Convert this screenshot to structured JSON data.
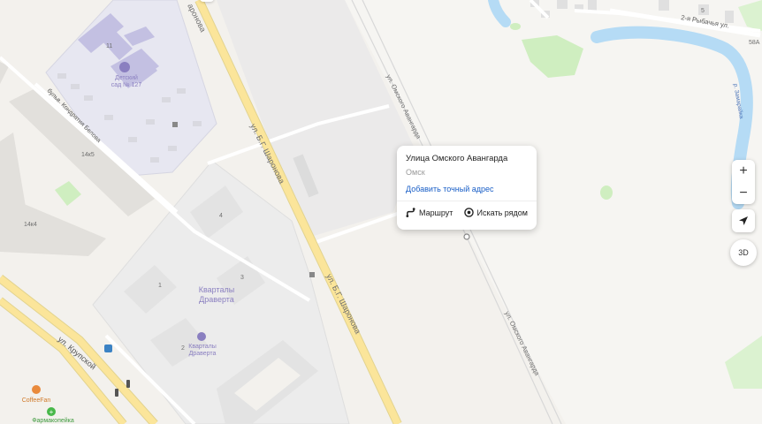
{
  "popup": {
    "title": "Улица Омского Авангарда",
    "city": "Омск",
    "add_address": "Добавить точный адрес",
    "route_label": "Маршрут",
    "search_nearby_label": "Искать рядом"
  },
  "controls": {
    "zoom_in": "+",
    "zoom_out": "−",
    "three_d": "3D"
  },
  "map_labels": {
    "street_sharonova": "ул. Б.Г. Шаронова",
    "street_sharonova_top": "аронова",
    "street_omskogo_avangarda": "ул. Омского Авангарда",
    "street_rybachya": "2-я Рыбачья ул.",
    "street_krupskoy": "ул. Крупской",
    "boulevard_belova": "бульв. Кондратия Белова",
    "river": "р. Замарайка",
    "kindergarten": "Детский сад № 127",
    "kindergarten_l1": "Детский",
    "kindergarten_l2": "сад № 127",
    "kvartaly": "Кварталы Драверта",
    "kvartaly_l1": "Кварталы",
    "kvartaly_l2": "Драверта",
    "kvartaly_poi_l1": "Кварталы",
    "kvartaly_poi_l2": "Драверта",
    "coffee": "CoffeeFan",
    "pharmacy": "Фармакопейка",
    "bldg_11": "11",
    "bldg_14k5": "14к5",
    "bldg_14k4": "14к4",
    "bldg_4": "4",
    "bldg_3": "3",
    "bldg_1": "1",
    "bldg_2": "2",
    "bldg_58a": "58А",
    "bldg_5": "5"
  },
  "colors": {
    "main_road": "#fbe59a",
    "water": "#b5dbf5",
    "park": "#cfeec0",
    "link": "#1a5fc7"
  }
}
